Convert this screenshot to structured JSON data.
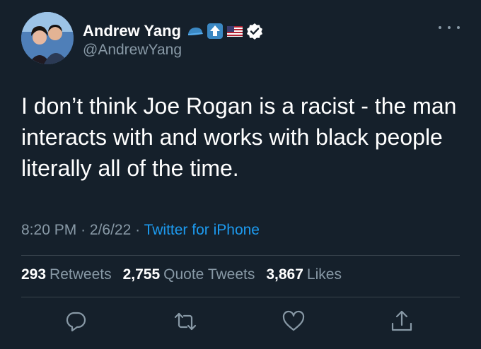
{
  "author": {
    "display_name": "Andrew Yang",
    "handle": "@AndrewYang",
    "verified": true,
    "name_emojis": [
      "blue-cap-icon",
      "up-arrow-icon",
      "us-flag-icon"
    ]
  },
  "tweet": {
    "text": "I don’t think Joe Rogan is a racist - the man interacts with and works with black people literally all of the time.",
    "time": "8:20 PM",
    "date": "2/6/22",
    "separator": "·",
    "source": "Twitter for iPhone"
  },
  "stats": {
    "retweets_count": "293",
    "retweets_label": "Retweets",
    "quotes_count": "2,755",
    "quotes_label": "Quote Tweets",
    "likes_count": "3,867",
    "likes_label": "Likes"
  },
  "actions": [
    "reply-icon",
    "retweet-icon",
    "like-icon",
    "share-icon"
  ],
  "colors": {
    "background": "#15202b",
    "text_primary": "#ffffff",
    "text_secondary": "#8899a6",
    "link": "#1d9bf0",
    "divider": "#38444d"
  }
}
